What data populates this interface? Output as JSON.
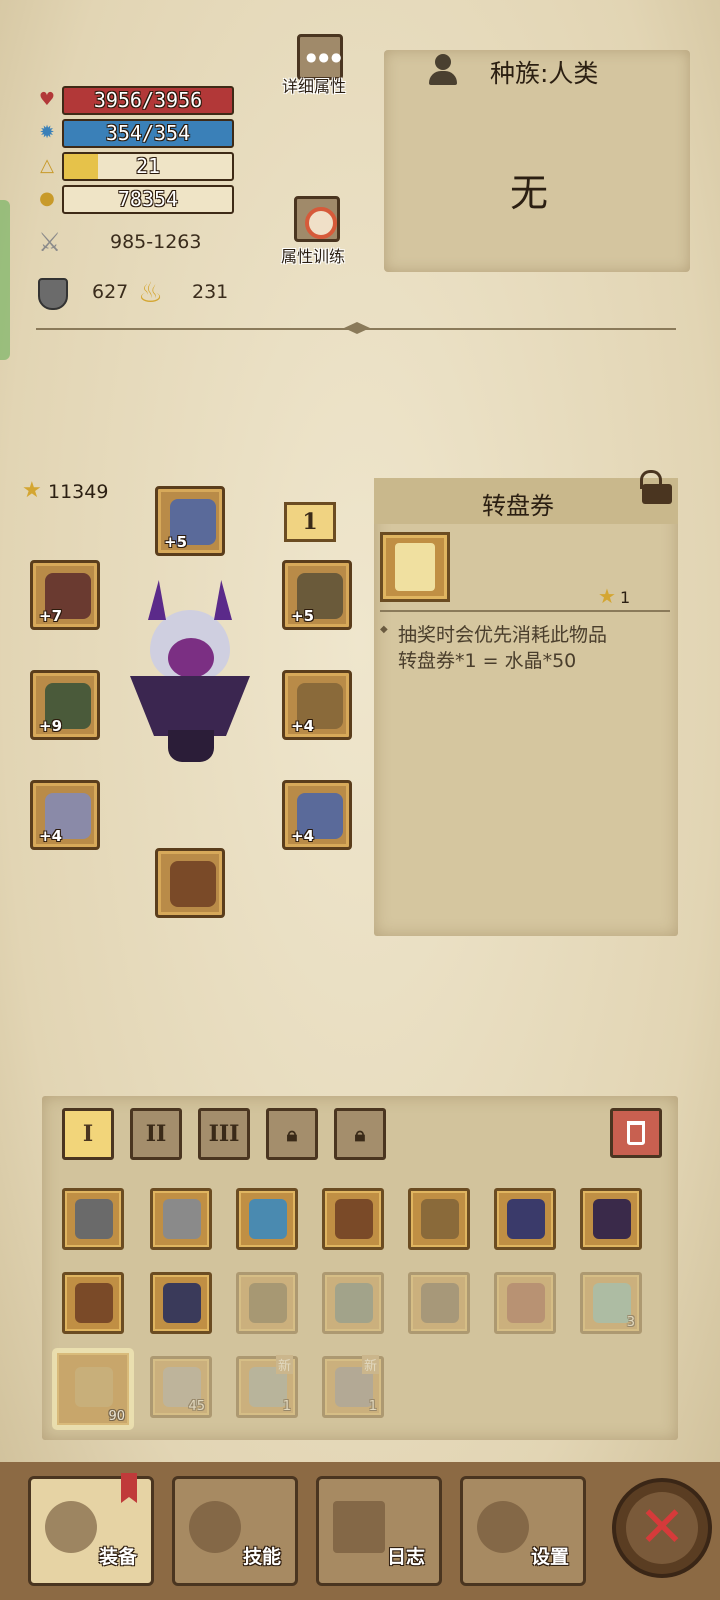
{
  "stats": {
    "hp": "3956/3956",
    "mp": "354/354",
    "level": "21",
    "level_progress": 0.2,
    "gold": "78354",
    "attack": "985-1263",
    "defense": "627",
    "strength": "231"
  },
  "buttons": {
    "detail_attributes": "详细属性",
    "attribute_training": "属性训练"
  },
  "race": {
    "label": "种族:人类",
    "value": "无"
  },
  "equipment": {
    "power": "11349",
    "page_badge": "1",
    "slots": [
      {
        "name": "helmet",
        "plus": "+5"
      },
      {
        "name": "ring",
        "plus": "+7"
      },
      {
        "name": "weapon",
        "plus": "+9"
      },
      {
        "name": "bracer",
        "plus": "+4"
      },
      {
        "name": "boots",
        "plus": ""
      },
      {
        "name": "necklace",
        "plus": "+5"
      },
      {
        "name": "armor",
        "plus": "+4"
      },
      {
        "name": "pants",
        "plus": "+4"
      }
    ]
  },
  "item_info": {
    "title": "转盘券",
    "stars": "1",
    "desc_line1": "抽奖时会优先消耗此物品",
    "desc_line2": "转盘券*1 = 水晶*50"
  },
  "inventory": {
    "tabs": [
      "I",
      "II",
      "III"
    ],
    "quantities": {
      "potion": "3",
      "scroll": "90",
      "shovel": "45",
      "map1": "1",
      "map2": "1"
    },
    "new_label": "新"
  },
  "nav": {
    "equip": "装备",
    "skills": "技能",
    "log": "日志",
    "settings": "设置"
  }
}
